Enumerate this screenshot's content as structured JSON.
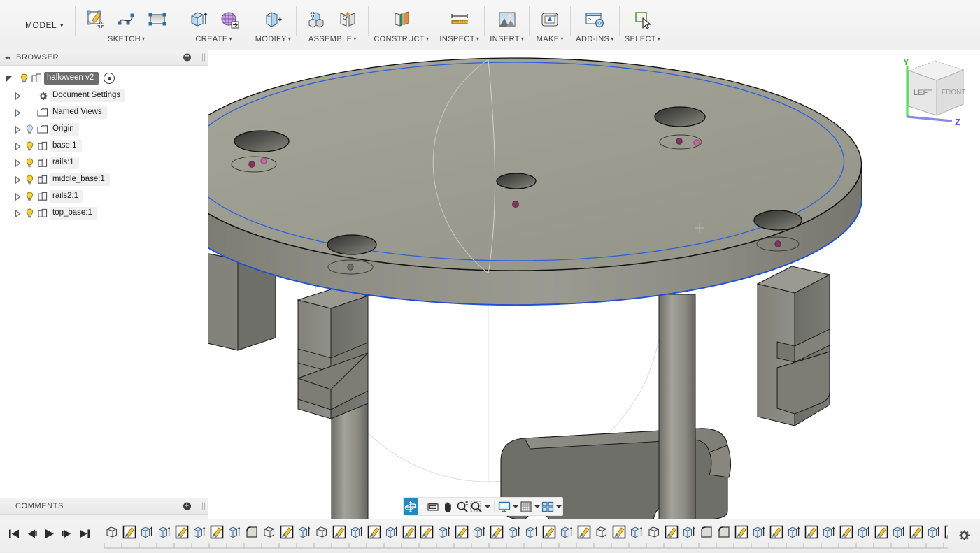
{
  "app": {
    "workspace_menu": "MODEL",
    "caret": "▾"
  },
  "toolbar": {
    "groups": [
      {
        "label": "SKETCH",
        "icons": [
          "create-sketch-icon",
          "spline-icon",
          "rectangle-icon"
        ]
      },
      {
        "label": "CREATE",
        "icons": [
          "extrude-icon",
          "create-form-icon"
        ]
      },
      {
        "label": "MODIFY",
        "icons": [
          "press-pull-icon"
        ]
      },
      {
        "label": "ASSEMBLE",
        "icons": [
          "new-component-icon",
          "joint-icon"
        ]
      },
      {
        "label": "CONSTRUCT",
        "icons": [
          "offset-plane-icon"
        ]
      },
      {
        "label": "INSPECT",
        "icons": [
          "measure-icon"
        ]
      },
      {
        "label": "INSERT",
        "icons": [
          "insert-image-icon"
        ]
      },
      {
        "label": "MAKE",
        "icons": [
          "3d-print-icon"
        ]
      },
      {
        "label": "ADD-INS",
        "icons": [
          "scripts-addins-icon"
        ]
      },
      {
        "label": "SELECT",
        "icons": [
          "select-icon"
        ]
      }
    ]
  },
  "browser": {
    "title": "BROWSER",
    "collapse_icon": "collapse-left-icon",
    "minimize_icon": "minimize-icon",
    "root": {
      "label": "halloween v2",
      "icon": "component-icon",
      "visibility_icon": "lightbulb-icon",
      "activate_icon": "radio-dot-icon",
      "expander": "triangle-down-icon"
    },
    "items": [
      {
        "label": "Document Settings",
        "icon": "gear-icon",
        "bulb": false,
        "expander": "triangle-right-icon"
      },
      {
        "label": "Named Views",
        "icon": "folder-icon",
        "bulb": false,
        "expander": "triangle-right-icon"
      },
      {
        "label": "Origin",
        "icon": "folder-icon",
        "bulb": true,
        "bulb_state": "off",
        "expander": "triangle-right-icon"
      },
      {
        "label": "base:1",
        "icon": "component-icon",
        "bulb": true,
        "bulb_state": "on",
        "expander": "triangle-right-icon"
      },
      {
        "label": "rails:1",
        "icon": "component-icon",
        "bulb": true,
        "bulb_state": "on",
        "expander": "triangle-right-icon"
      },
      {
        "label": "middle_base:1",
        "icon": "component-icon",
        "bulb": true,
        "bulb_state": "on",
        "expander": "triangle-right-icon"
      },
      {
        "label": "rails2:1",
        "icon": "component-icon",
        "bulb": true,
        "bulb_state": "on",
        "expander": "triangle-right-icon"
      },
      {
        "label": "top_base:1",
        "icon": "component-icon",
        "bulb": true,
        "bulb_state": "on",
        "expander": "triangle-right-icon"
      }
    ]
  },
  "comments": {
    "title": "COMMENTS",
    "add_icon": "add-comment-icon"
  },
  "viewcube": {
    "face_left": "LEFT",
    "face_front": "FRONT",
    "axis_y": "Y",
    "axis_z": "Z",
    "axis_y_color": "#5ee05e",
    "axis_z_color": "#6f6fe8"
  },
  "view_toolbar": {
    "buttons": [
      {
        "name": "orbit-button",
        "icon": "orbit-icon",
        "active": true,
        "caret": true
      },
      {
        "name": "fit-button",
        "icon": "fit-icon",
        "active": false,
        "caret": false
      },
      {
        "name": "pan-button",
        "icon": "pan-hand-icon",
        "active": false,
        "caret": false
      },
      {
        "name": "zoom-button",
        "icon": "zoom-icon",
        "active": false,
        "caret": false
      },
      {
        "name": "zoom-window-button",
        "icon": "zoom-window-icon",
        "active": false,
        "caret": true
      },
      {
        "name": "display-settings-button",
        "icon": "display-icon",
        "active": false,
        "caret": true
      },
      {
        "name": "grid-snaps-button",
        "icon": "grid-icon",
        "active": false,
        "caret": true
      },
      {
        "name": "viewports-button",
        "icon": "viewport-grid-icon",
        "active": false,
        "caret": true
      }
    ]
  },
  "timeline": {
    "playback": [
      {
        "name": "go-to-beginning-button",
        "icon": "skip-start-icon"
      },
      {
        "name": "step-back-button",
        "icon": "step-back-icon"
      },
      {
        "name": "play-button",
        "icon": "play-icon"
      },
      {
        "name": "step-forward-button",
        "icon": "step-forward-icon"
      },
      {
        "name": "go-to-end-button",
        "icon": "skip-end-icon"
      }
    ],
    "features": [
      "body-icon",
      "sketch-icon",
      "extrude-icon",
      "extrude-icon",
      "sketch-icon",
      "extrude-icon",
      "sketch-icon",
      "extrude-icon",
      "fillet-icon",
      "body-icon",
      "sketch-icon",
      "extrude-icon",
      "body-icon",
      "sketch-icon",
      "extrude-icon",
      "sketch-icon",
      "extrude-icon",
      "sketch-icon",
      "sketch-icon",
      "extrude-icon",
      "sketch-icon",
      "extrude-icon",
      "sketch-icon",
      "extrude-icon",
      "extrude-icon",
      "sketch-icon",
      "extrude-icon",
      "sketch-icon",
      "body-icon",
      "sketch-icon",
      "extrude-icon",
      "body-icon",
      "sketch-icon",
      "extrude-icon",
      "fillet-icon",
      "fillet-icon",
      "sketch-icon",
      "extrude-icon",
      "sketch-icon",
      "extrude-icon",
      "sketch-icon",
      "extrude-icon",
      "sketch-icon",
      "extrude-icon",
      "sketch-icon",
      "extrude-icon",
      "sketch-icon",
      "extrude-icon",
      "sketch-icon",
      "extrude-icon"
    ],
    "end_marker_icon": "timeline-marker-icon",
    "settings_icon": "gear-icon"
  },
  "model": {
    "description": "Shaded 3D assembly: circular top plate with bolt holes, vertical rails and posts, middle base plate",
    "colors": {
      "surface_top": "#9e9e93",
      "surface_side": "#8b8b82",
      "rail_face": "#8d8d85",
      "rail_dark": "#70706a",
      "edge": "#1a1a1a",
      "highlight_edge": "#1e4fd8",
      "sketch_point": "#8a3a6a",
      "sketch_point_light": "#c46fa6",
      "construction_line": "#d8d8d8",
      "background": "#ffffff"
    }
  }
}
